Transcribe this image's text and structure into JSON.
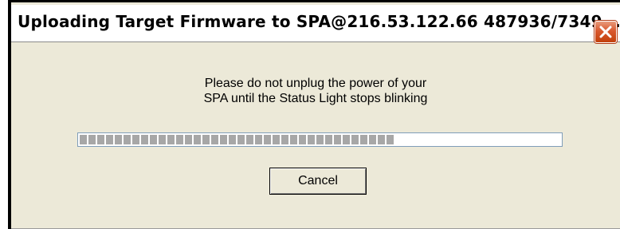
{
  "window": {
    "title": "Uploading Target Firmware to SPA@216.53.122.66 487936/7349..."
  },
  "message": {
    "line1": "Please do not unplug the power of your",
    "line2": "SPA until the Status Light stops blinking"
  },
  "progress": {
    "percent": 66
  },
  "buttons": {
    "cancel_label": "Cancel"
  },
  "icons": {
    "close": "close-icon"
  },
  "colors": {
    "dialog_background": "#ece9d8",
    "close_button": "#d9582e",
    "progress_block": "#a7a7a7",
    "progress_border": "#7f9db9"
  }
}
